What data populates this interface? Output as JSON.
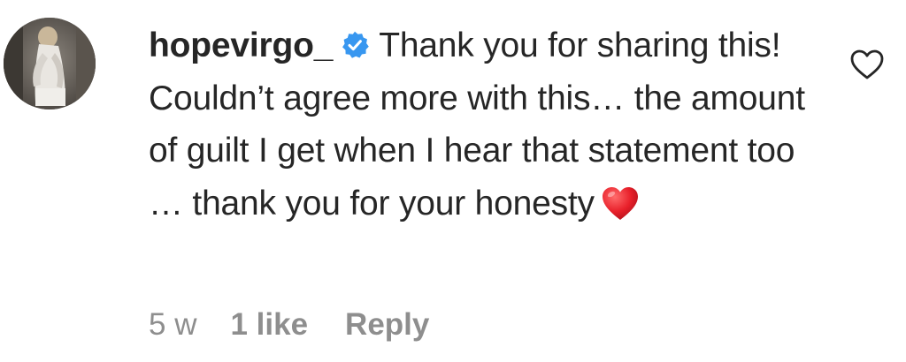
{
  "comment": {
    "username": "hopevirgo_",
    "verified": true,
    "text_before_emoji": "Thank you for sharing this! Couldn’t agree more with this… the amount of guilt I get when I hear that statement too … thank you for your honesty",
    "emoji": "red-heart",
    "time": "5 w",
    "likes": "1 like",
    "reply_label": "Reply"
  },
  "icons": {
    "verified_badge": "verified-badge-icon",
    "like": "heart-outline-icon",
    "emoji": "red-heart-emoji"
  },
  "colors": {
    "text": "#262626",
    "meta": "#8e8e8e",
    "verified": "#3897f0",
    "emoji_heart": "#e8202a"
  }
}
